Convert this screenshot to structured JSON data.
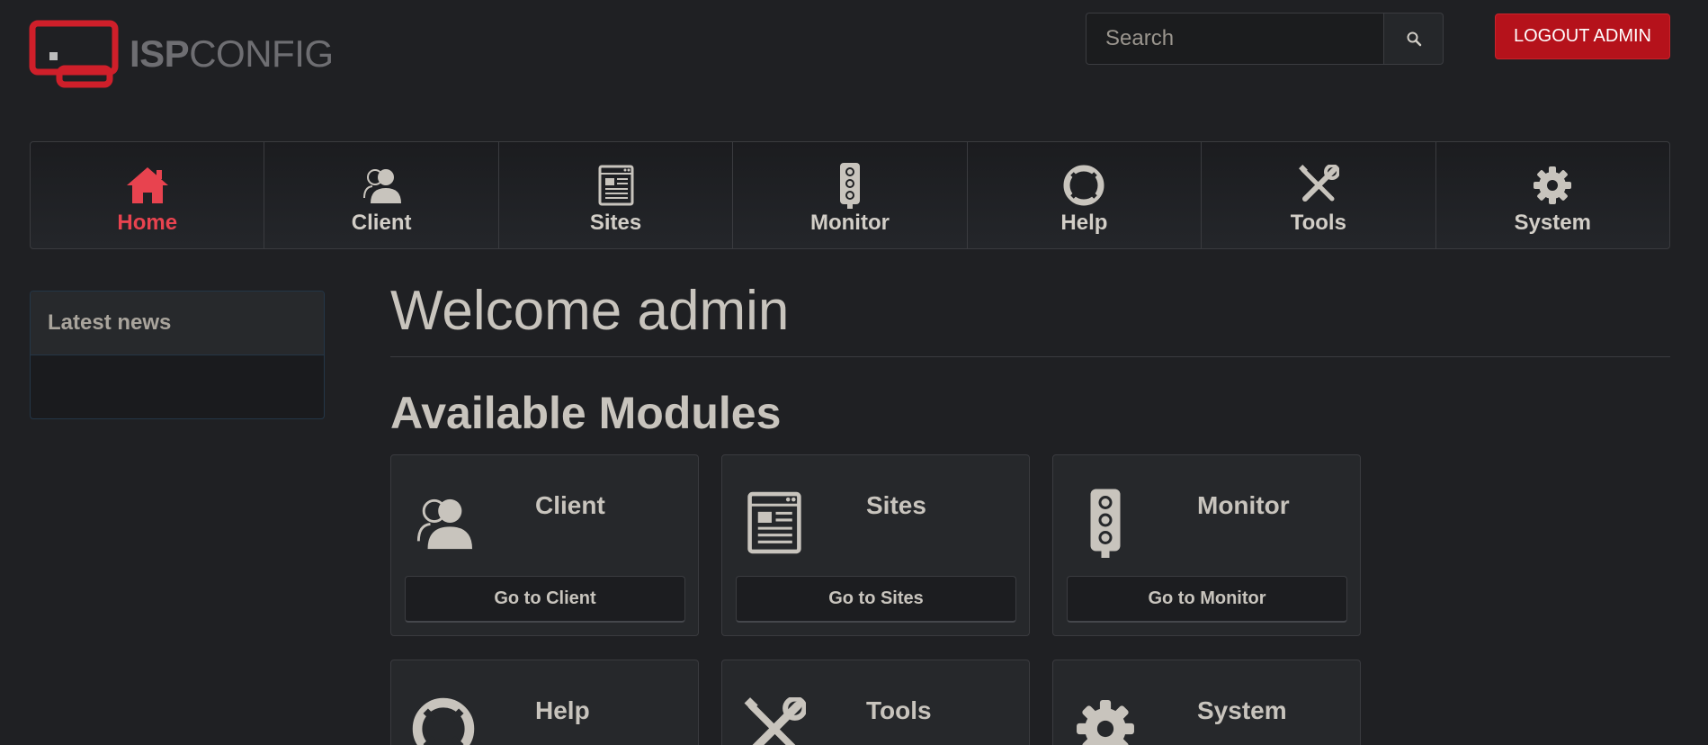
{
  "header": {
    "logo_text_bold": "ISP",
    "logo_text_light": "CONFIG",
    "search_placeholder": "Search",
    "logout_label": "LOGOUT ADMIN"
  },
  "nav": {
    "items": [
      {
        "label": "Home",
        "icon": "home-icon",
        "active": true
      },
      {
        "label": "Client",
        "icon": "client-icon"
      },
      {
        "label": "Sites",
        "icon": "sites-icon"
      },
      {
        "label": "Monitor",
        "icon": "monitor-icon"
      },
      {
        "label": "Help",
        "icon": "help-icon"
      },
      {
        "label": "Tools",
        "icon": "tools-icon"
      },
      {
        "label": "System",
        "icon": "system-icon"
      }
    ]
  },
  "sidebar": {
    "news_title": "Latest news"
  },
  "main": {
    "welcome": "Welcome admin",
    "modules_heading": "Available Modules",
    "modules": [
      {
        "title": "Client",
        "button": "Go to Client",
        "icon": "client-icon"
      },
      {
        "title": "Sites",
        "button": "Go to Sites",
        "icon": "sites-icon"
      },
      {
        "title": "Monitor",
        "button": "Go to Monitor",
        "icon": "monitor-icon"
      },
      {
        "title": "Help",
        "icon": "help-icon"
      },
      {
        "title": "Tools",
        "icon": "tools-icon"
      },
      {
        "title": "System",
        "icon": "system-icon"
      }
    ]
  },
  "colors": {
    "accent": "#e8434f",
    "logout": "#b5121b",
    "background": "#1f2023",
    "icon": "#c8c4bd"
  }
}
